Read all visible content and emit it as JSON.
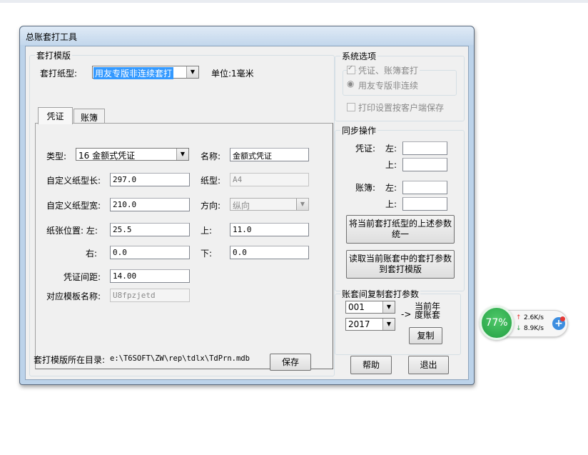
{
  "window": {
    "title": "总账套打工具"
  },
  "template_group": {
    "legend": "套打模版",
    "paper_type_label": "套打纸型:",
    "paper_type_value": "用友专版非连续套打",
    "unit_label": "单位:1毫米",
    "tabs": [
      {
        "label": "凭证"
      },
      {
        "label": "账簿"
      }
    ],
    "fields": {
      "type_label": "类型:",
      "type_value": "16 金额式凭证",
      "name_label": "名称:",
      "name_value": "金额式凭证",
      "custom_length_label": "自定义纸型长:",
      "custom_length_value": "297.0",
      "paper_label": "纸型:",
      "paper_value": "A4",
      "custom_width_label": "自定义纸型宽:",
      "custom_width_value": "210.0",
      "direction_label": "方向:",
      "direction_value": "纵向",
      "position_label": "纸张位置: 左:",
      "left_value": "25.5",
      "top_label": "上:",
      "top_value": "11.0",
      "right_label": "右:",
      "right_value": "0.0",
      "bottom_label": "下:",
      "bottom_value": "0.0",
      "spacing_label": "凭证间距:",
      "spacing_value": "14.00",
      "template_name_label": "对应模板名称:",
      "template_name_value": "U8fpzjetd"
    },
    "dir_label": "套打模版所在目录:",
    "dir_value": "e:\\T6SOFT\\ZW\\rep\\tdlx\\TdPrn.mdb",
    "save_button": "保存"
  },
  "system_options": {
    "legend": "系统选项",
    "voucher_ledger_check": "凭证、账簿套打",
    "yonyou_radio": "用友专版非连续",
    "print_settings_check": "打印设置按客户端保存"
  },
  "sync": {
    "legend": "同步操作",
    "voucher_label": "凭证:",
    "ledger_label": "账簿:",
    "left_label": "左:",
    "top_label": "上:",
    "unify_button": "将当前套打纸型的上述参数统一",
    "read_button": "读取当前账套中的套打参数到套打模版"
  },
  "copy_params": {
    "legend": "账套间复制套打参数",
    "account_value": "001",
    "year_value": "2017",
    "arrow_text": "->",
    "target_text": "当前年度账套",
    "copy_button": "复制"
  },
  "footer": {
    "help_button": "帮助",
    "exit_button": "退出"
  },
  "net_widget": {
    "percent": "77%",
    "upload": "2.6K/s",
    "download": "8.9K/s"
  }
}
